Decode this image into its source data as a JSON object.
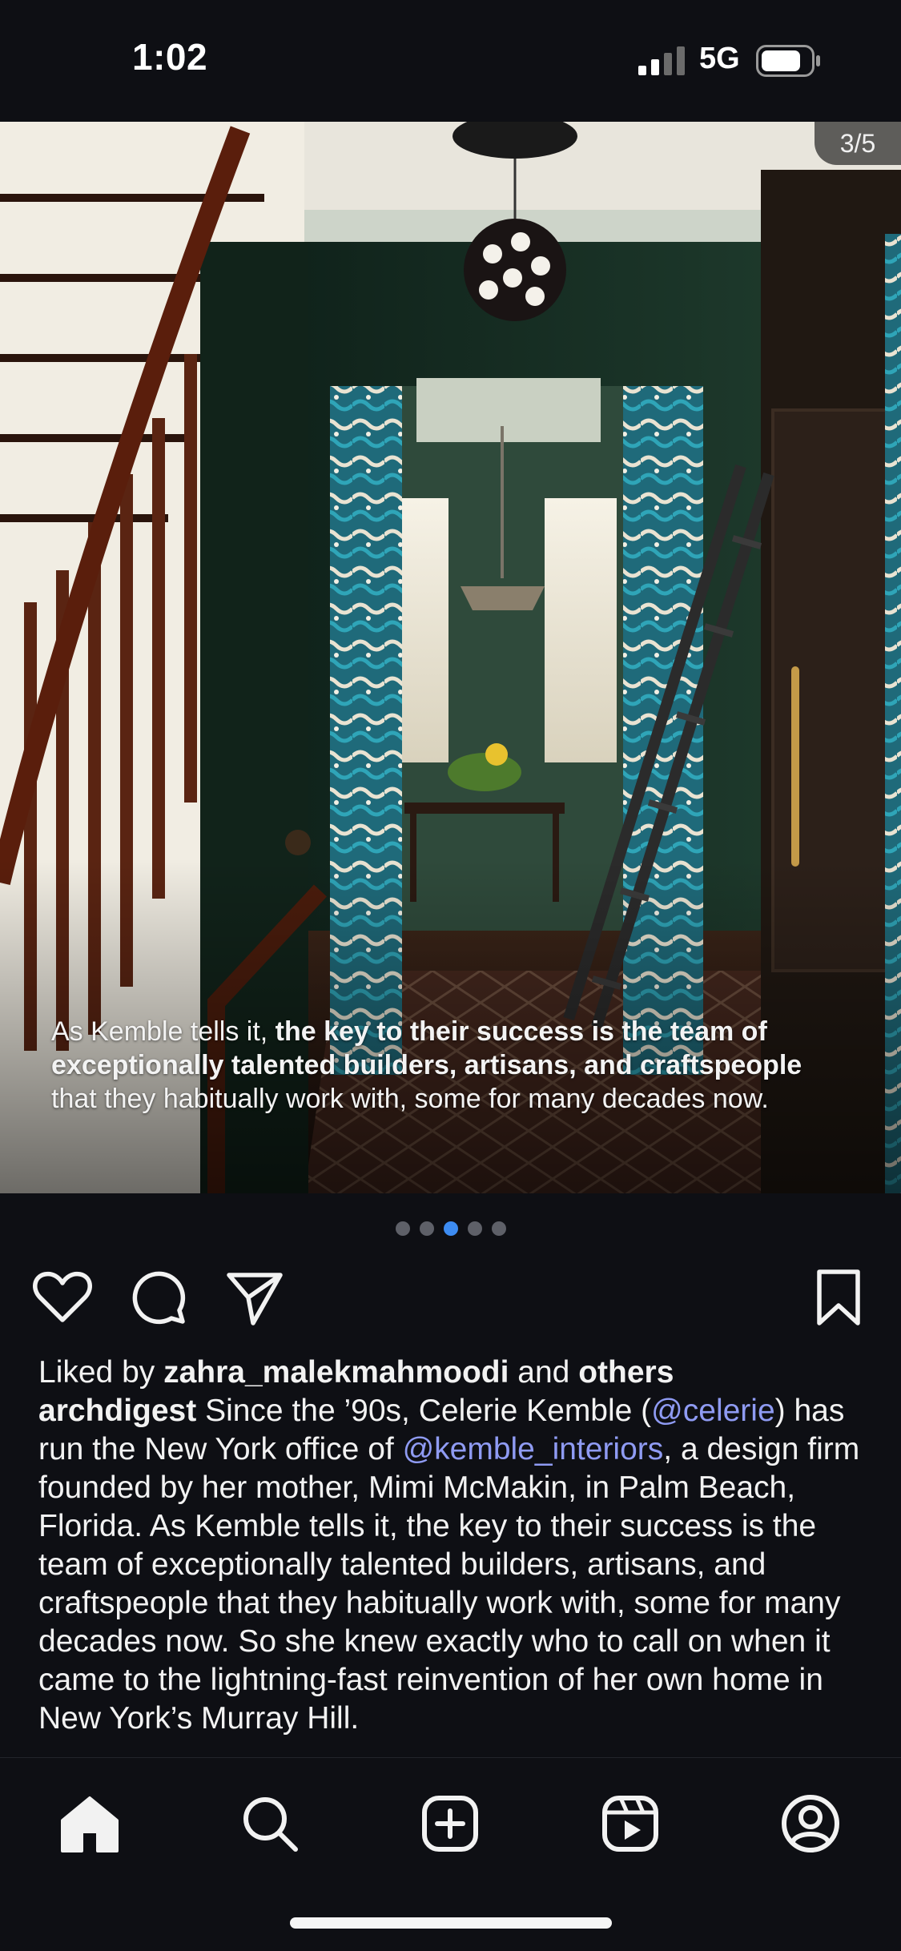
{
  "status_bar": {
    "time": "1:02",
    "network": "5G",
    "signal_icon": "signal-bars-icon",
    "battery_icon": "battery-icon"
  },
  "post": {
    "image_counter": "3/5",
    "image_overlay": {
      "part1": "As Kemble tells it, ",
      "bold1": "the key to their success is the team of exceptionally talented builders, artisans, and craftspeople",
      "part2": " that they habitually work with, some for many decades now."
    },
    "carousel": {
      "total": 5,
      "active_index": 2
    },
    "actions": {
      "like_icon": "heart-icon",
      "comment_icon": "comment-bubble-icon",
      "share_icon": "paper-plane-icon",
      "save_icon": "bookmark-icon"
    },
    "likes": {
      "prefix": "Liked by ",
      "user": "zahra_malekmahmoodi",
      "middle": " and ",
      "others": "others"
    },
    "caption": {
      "author": "archdigest",
      "t1": " Since the ’90s, Celerie Kemble (",
      "mention1": "@celerie",
      "t2": ") has run the New York office of ",
      "mention2": "@kemble_interiors",
      "t3": ", a design firm founded by her mother, Mimi McMakin, in Palm Beach, Florida. As Kemble tells it, the key to their success is the team of exceptionally talented builders, artisans, and craftspeople that they habitually work with, some for many decades now. So she knew exactly who to call on when it came to the lightning-fast reinvention of her own home in New York’s Murray Hill."
    }
  },
  "bottom_nav": {
    "items": [
      "home-icon",
      "search-icon",
      "create-post-icon",
      "reels-icon",
      "profile-icon"
    ]
  },
  "colors": {
    "background": "#0e0f14",
    "accent": "#3d8cf2",
    "mention": "#8f9bf3"
  }
}
